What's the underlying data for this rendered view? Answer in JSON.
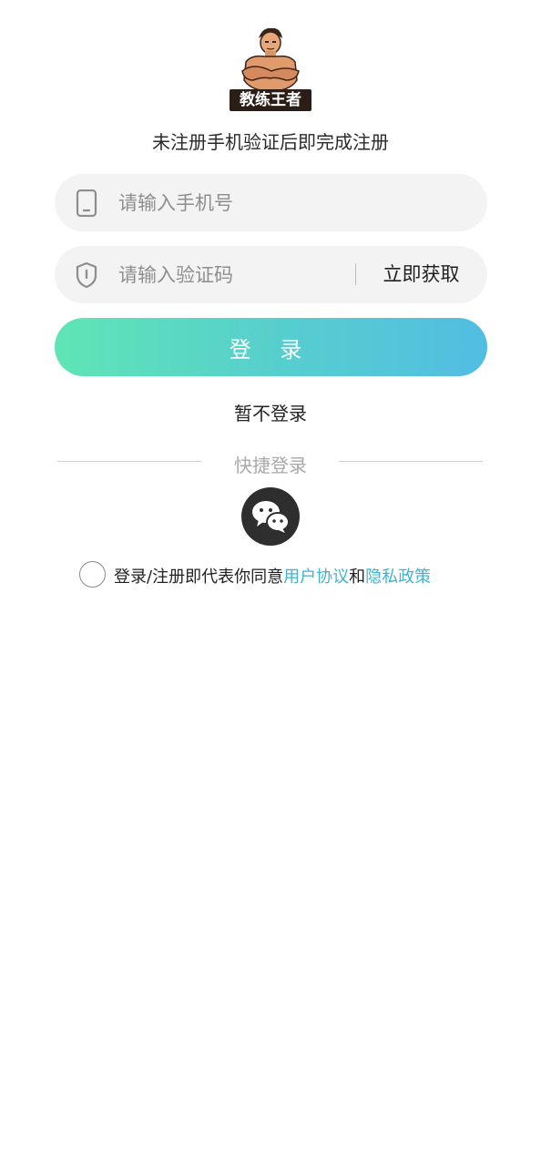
{
  "logo": {
    "text": "教练王者"
  },
  "subtitle": "未注册手机验证后即完成注册",
  "phone": {
    "placeholder": "请输入手机号",
    "value": ""
  },
  "code": {
    "placeholder": "请输入验证码",
    "value": "",
    "get_code_label": "立即获取"
  },
  "login_label": "登 录",
  "skip_label": "暂不登录",
  "quick_login_title": "快捷登录",
  "agreement": {
    "prefix": "登录/注册即代表你同意",
    "user_agreement": "用户协议",
    "and": "和",
    "privacy_policy": "隐私政策"
  },
  "colors": {
    "gradient_start": "#5fe5b5",
    "gradient_end": "#52bde3",
    "link": "#3fb3cf"
  },
  "icons": [
    "phone-icon",
    "shield-icon",
    "wechat-icon"
  ]
}
